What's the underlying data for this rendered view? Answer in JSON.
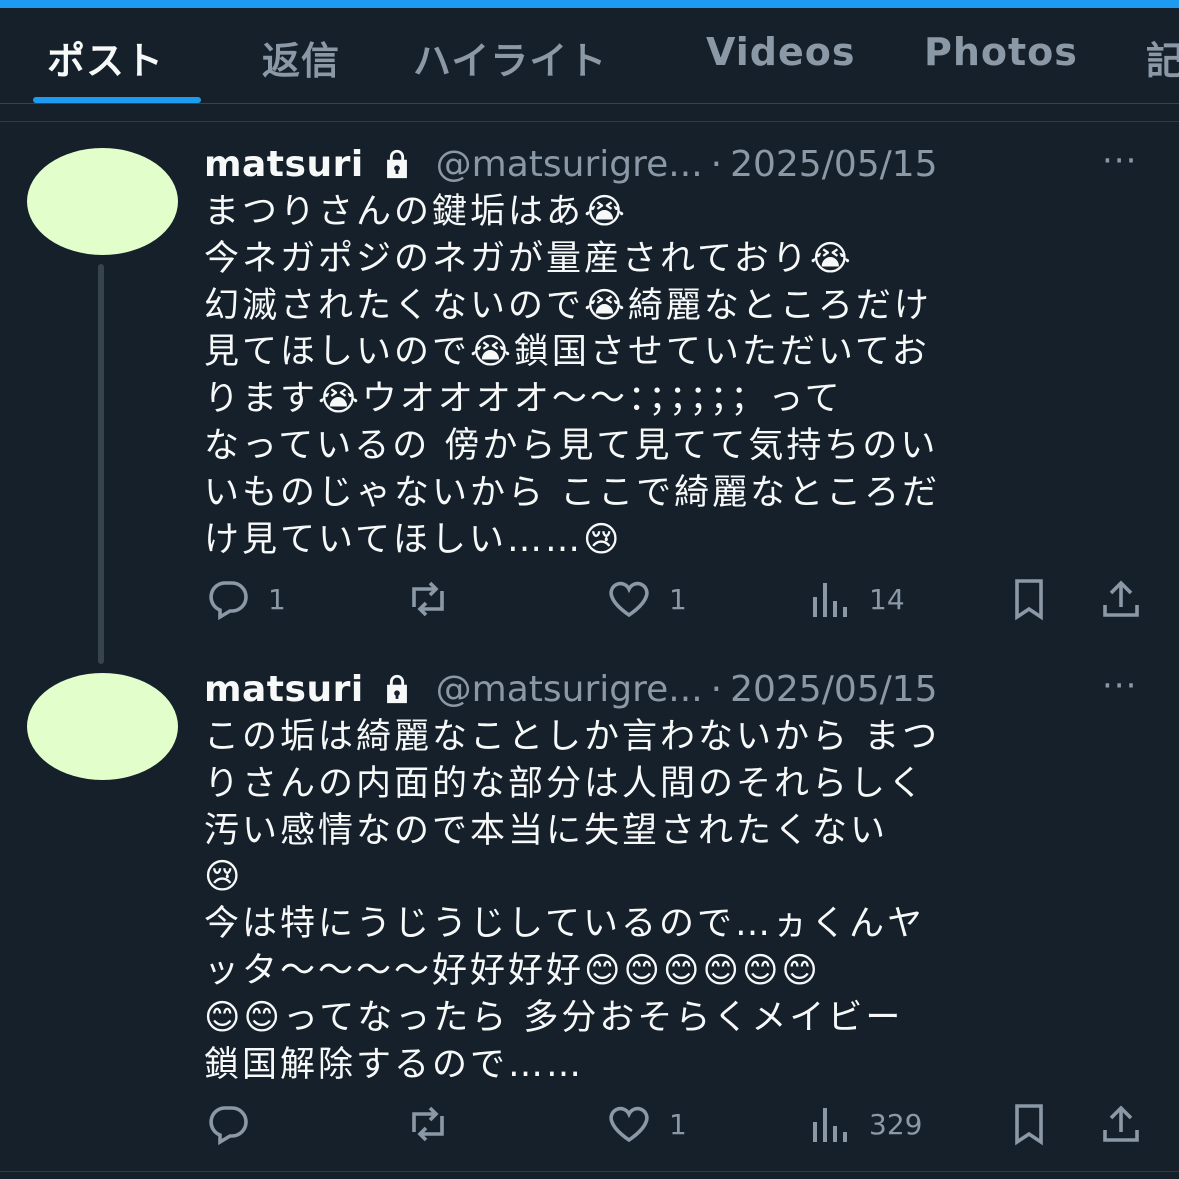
{
  "tabs": [
    {
      "label": "ポスト"
    },
    {
      "label": "返信"
    },
    {
      "label": "ハイライト"
    },
    {
      "label": "Videos"
    },
    {
      "label": "Photos"
    },
    {
      "label": "記"
    }
  ],
  "posts": [
    {
      "name": "matsuri",
      "handle": "@matsurigre...",
      "dot": "·",
      "date": "2025/05/15",
      "more": "···",
      "lines": [
        "まつりさんの鍵垢はあ😭",
        "今ネガポジのネガが量産されており😭",
        "幻滅されたくないので😭綺麗なところだけ",
        "見てほしいので😭鎖国させていただいてお",
        "ります😭ウオオオオ〜〜：；；；；；って",
        "なっているの 傍から見て見てて気持ちのい",
        "いものじゃないから ここで綺麗なところだ",
        "け見ていてほしい……😢"
      ],
      "reply_count": "1",
      "retweet_count": "",
      "like_count": "1",
      "view_count": "14"
    },
    {
      "name": "matsuri",
      "handle": "@matsurigre...",
      "dot": "·",
      "date": "2025/05/15",
      "more": "···",
      "lines": [
        "この垢は綺麗なことしか言わないから まつ",
        "りさんの内面的な部分は人間のそれらしく",
        "汚い感情なので本当に失望されたくない",
        "😢",
        "今は特にうじうじしているので…ヵくんヤ",
        "ッタ〜〜〜〜好好好好😊😊😊😊😊😊",
        "😊😊ってなったら 多分おそらくメイビー",
        "鎖国解除するので……"
      ],
      "reply_count": "",
      "retweet_count": "",
      "like_count": "1",
      "view_count": "329"
    }
  ],
  "icons": {
    "lock": "lock-icon",
    "reply": "reply-icon",
    "retweet": "retweet-icon",
    "like": "heart-icon",
    "views": "views-icon",
    "bookmark": "bookmark-icon",
    "share": "share-icon"
  },
  "colors": {
    "background": "#15202b",
    "accent": "#1d9bf0",
    "muted": "#8b98a5",
    "avatar": "#e1fecb"
  }
}
